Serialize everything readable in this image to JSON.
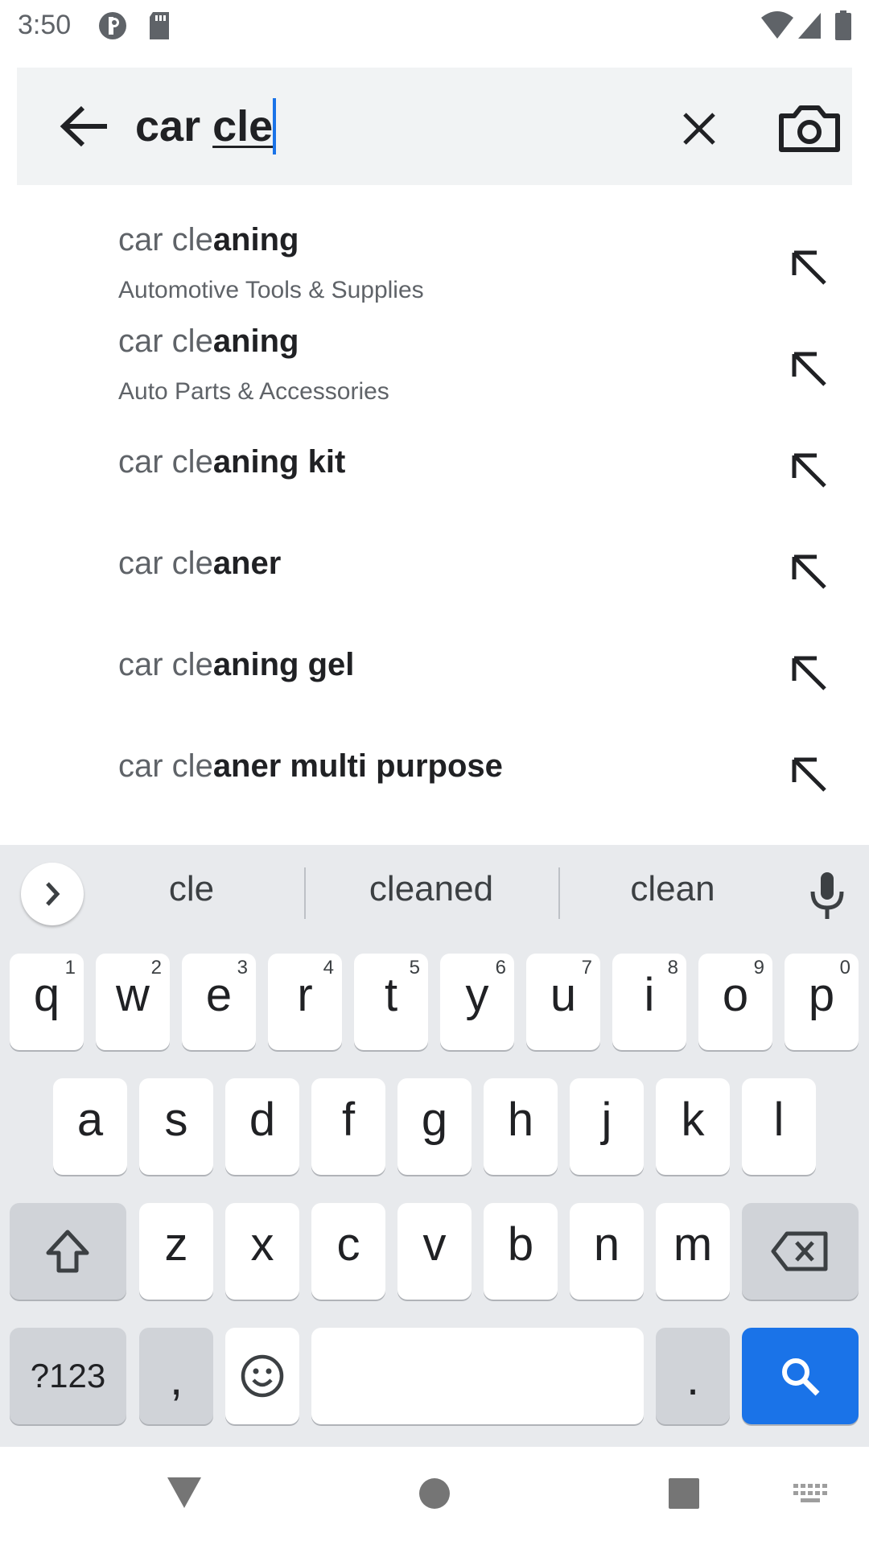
{
  "status_bar": {
    "time": "3:50",
    "icons": [
      "privacy-indicator-icon",
      "sd-card-icon",
      "wifi-icon",
      "signal-icon",
      "battery-icon"
    ]
  },
  "search": {
    "query_prefix": "car ",
    "query_typed": "cle",
    "back_icon": "arrow-left-icon",
    "clear_icon": "close-icon",
    "camera_icon": "camera-icon"
  },
  "suggestions": [
    {
      "typed": "car cle",
      "completion": "aning",
      "category": "Automotive Tools & Supplies"
    },
    {
      "typed": "car cle",
      "completion": "aning",
      "category": "Auto Parts & Accessories"
    },
    {
      "typed": "car cle",
      "completion": "aning kit",
      "category": ""
    },
    {
      "typed": "car cle",
      "completion": "aner",
      "category": ""
    },
    {
      "typed": "car cle",
      "completion": "aning gel",
      "category": ""
    },
    {
      "typed": "car cle",
      "completion": "aner multi purpose",
      "category": ""
    }
  ],
  "keyboard": {
    "word_suggestions": [
      "cle",
      "cleaned",
      "clean"
    ],
    "row1": [
      {
        "ch": "q",
        "hint": "1"
      },
      {
        "ch": "w",
        "hint": "2"
      },
      {
        "ch": "e",
        "hint": "3"
      },
      {
        "ch": "r",
        "hint": "4"
      },
      {
        "ch": "t",
        "hint": "5"
      },
      {
        "ch": "y",
        "hint": "6"
      },
      {
        "ch": "u",
        "hint": "7"
      },
      {
        "ch": "i",
        "hint": "8"
      },
      {
        "ch": "o",
        "hint": "9"
      },
      {
        "ch": "p",
        "hint": "0"
      }
    ],
    "row2": [
      "a",
      "s",
      "d",
      "f",
      "g",
      "h",
      "j",
      "k",
      "l"
    ],
    "row3": [
      "z",
      "x",
      "c",
      "v",
      "b",
      "n",
      "m"
    ],
    "symbols_label": "?123",
    "comma_label": ",",
    "period_label": ".",
    "action_icon": "search-icon",
    "accent_color": "#1a73e8"
  },
  "nav_bar": {
    "icons": [
      "back-triangle-icon",
      "home-circle-icon",
      "recents-square-icon",
      "keyboard-switch-icon"
    ]
  }
}
